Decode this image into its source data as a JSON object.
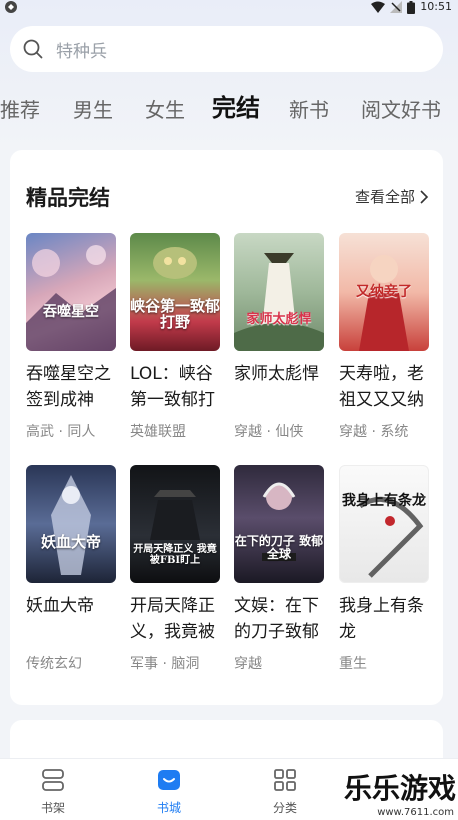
{
  "status_bar": {
    "time": "10:51"
  },
  "search": {
    "placeholder": "特种兵"
  },
  "tabs": [
    {
      "label": "推荐"
    },
    {
      "label": "男生"
    },
    {
      "label": "女生"
    },
    {
      "label": "完结"
    },
    {
      "label": "新书"
    },
    {
      "label": "阅文好书"
    }
  ],
  "section": {
    "title": "精品完结",
    "view_all": "查看全部"
  },
  "books": [
    {
      "title": "吞噬星空之签到成神",
      "tags": "高武 · 同人",
      "cover_text": "吞噬星空",
      "cover_color": "#b98aa0"
    },
    {
      "title": "LOL：峡谷第一致郁打",
      "tags": "英雄联盟",
      "cover_text": "峡谷第一致郁打野",
      "cover_color": "#c03a4a"
    },
    {
      "title": "家师太彪悍",
      "tags": "穿越 · 仙侠",
      "cover_text": "家师太彪悍",
      "cover_color": "#8aa67a"
    },
    {
      "title": "天寿啦，老祖又又又纳",
      "tags": "穿越 · 系统",
      "cover_text": "又纳妾了",
      "cover_color": "#e07a6a"
    },
    {
      "title": "妖血大帝",
      "tags": "传统玄幻",
      "cover_text": "妖血大帝",
      "cover_color": "#3a4a6a"
    },
    {
      "title": "开局天降正义，我竟被",
      "tags": "军事 · 脑洞",
      "cover_text": "开局天降正义 我竟被FBI盯上",
      "cover_color": "#1f2228"
    },
    {
      "title": "文娱：在下的刀子致郁",
      "tags": "穿越",
      "cover_text": "在下的刀子 致郁全球",
      "cover_color": "#3b3550"
    },
    {
      "title": "我身上有条龙",
      "tags": "重生",
      "cover_text": "我身上有条龙",
      "cover_color": "#eeeeee"
    }
  ],
  "bottom_nav": [
    {
      "label": "书架"
    },
    {
      "label": "书城"
    },
    {
      "label": "分类"
    }
  ],
  "watermark": {
    "text": "乐乐游戏",
    "url": "www.7611.com"
  },
  "colors": {
    "accent": "#1e7cf2",
    "background": "#f2f4f8"
  }
}
